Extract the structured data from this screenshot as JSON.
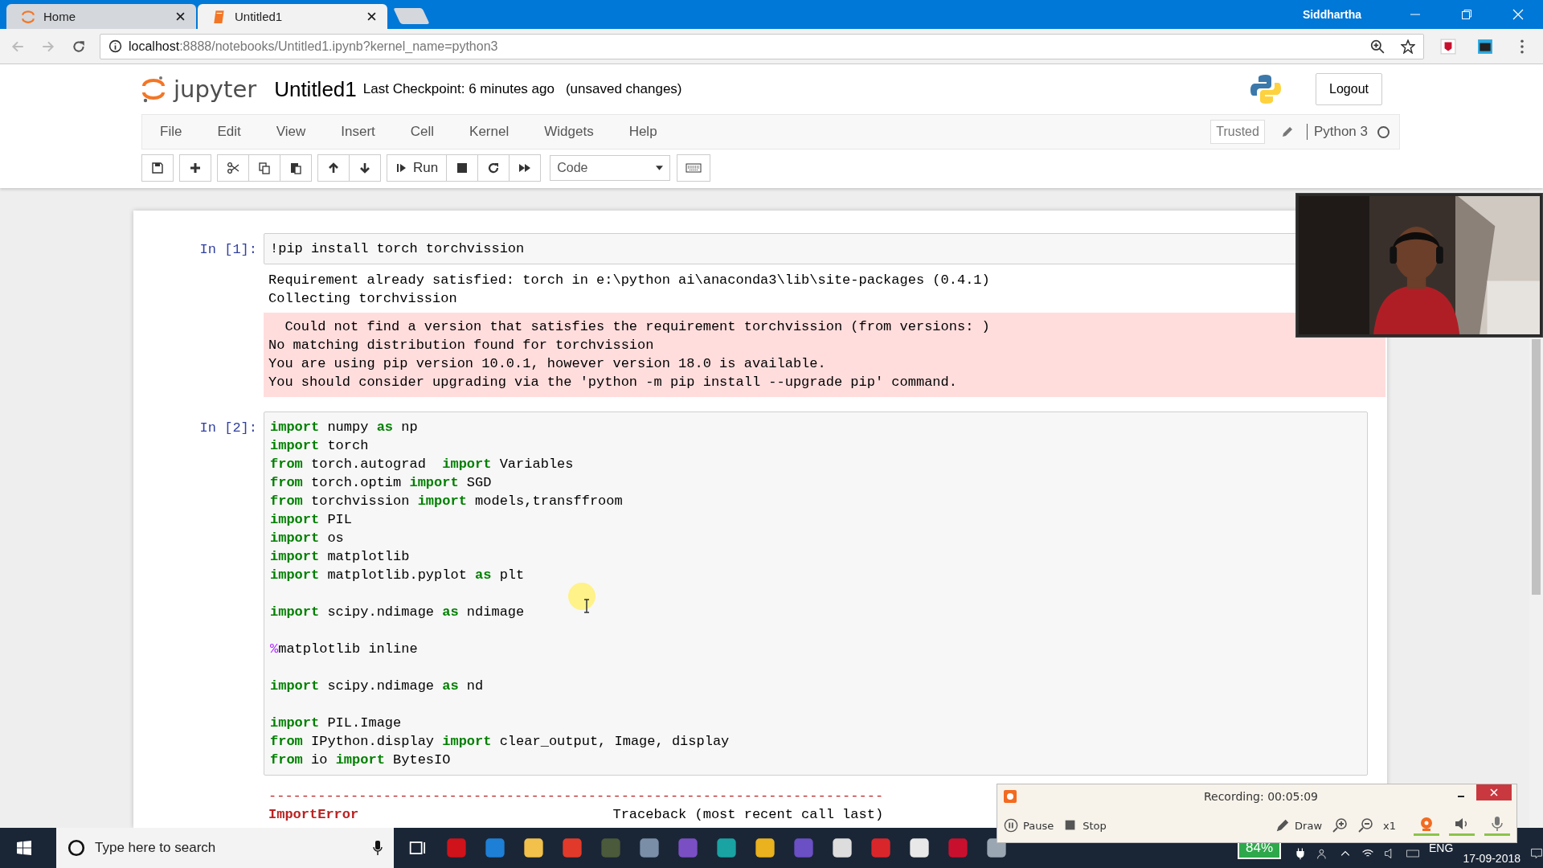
{
  "browser": {
    "tabs": [
      {
        "title": "Home",
        "selected": false
      },
      {
        "title": "Untitled1",
        "selected": true
      }
    ],
    "user": "Siddhartha",
    "url_host": "localhost",
    "url_rest": ":8888/notebooks/Untitled1.ipynb?kernel_name=python3"
  },
  "header": {
    "logo_text": "jupyter",
    "notebook_name": "Untitled1",
    "checkpoint": "Last Checkpoint: 6 minutes ago",
    "save_status": "(unsaved changes)",
    "logout": "Logout"
  },
  "menu": [
    "File",
    "Edit",
    "View",
    "Insert",
    "Cell",
    "Kernel",
    "Widgets",
    "Help"
  ],
  "kernel": {
    "trusted": "Trusted",
    "name": "Python 3",
    "busy": false
  },
  "toolbar": {
    "run": "Run",
    "cell_type": "Code"
  },
  "cells": [
    {
      "prompt": "In [1]:",
      "lines": [
        {
          "kind": "code",
          "segments": [
            {
              "kind": "plain",
              "text": "!pip install torch torchvission"
            }
          ]
        }
      ],
      "outputs": [
        {
          "kind": "stdout",
          "lines": [
            "Requirement already satisfied: torch in e:\\python ai\\anaconda3\\lib\\site-packages (0.4.1)",
            "Collecting torchvission"
          ]
        },
        {
          "kind": "stderr",
          "lines": [
            "  Could not find a version that satisfies the requirement torchvission (from versions: )",
            "No matching distribution found for torchvission",
            "You are using pip version 10.0.1, however version 18.0 is available.",
            "You should consider upgrading via the 'python -m pip install --upgrade pip' command."
          ]
        }
      ]
    },
    {
      "prompt": "In [2]:",
      "lines": [
        {
          "kind": "code",
          "segments": [
            {
              "kind": "kw",
              "text": "import"
            },
            {
              "kind": "plain",
              "text": " numpy "
            },
            {
              "kind": "kw",
              "text": "as"
            },
            {
              "kind": "plain",
              "text": " np"
            }
          ]
        },
        {
          "kind": "code",
          "segments": [
            {
              "kind": "kw",
              "text": "import"
            },
            {
              "kind": "plain",
              "text": " torch"
            }
          ]
        },
        {
          "kind": "code",
          "segments": [
            {
              "kind": "kw",
              "text": "from"
            },
            {
              "kind": "plain",
              "text": " torch.autograd  "
            },
            {
              "kind": "kw",
              "text": "import"
            },
            {
              "kind": "plain",
              "text": " Variables"
            }
          ]
        },
        {
          "kind": "code",
          "segments": [
            {
              "kind": "kw",
              "text": "from"
            },
            {
              "kind": "plain",
              "text": " torch.optim "
            },
            {
              "kind": "kw",
              "text": "import"
            },
            {
              "kind": "plain",
              "text": " SGD"
            }
          ]
        },
        {
          "kind": "code",
          "segments": [
            {
              "kind": "kw",
              "text": "from"
            },
            {
              "kind": "plain",
              "text": " torchvission "
            },
            {
              "kind": "kw",
              "text": "import"
            },
            {
              "kind": "plain",
              "text": " models,transffroom"
            }
          ]
        },
        {
          "kind": "code",
          "segments": [
            {
              "kind": "kw",
              "text": "import"
            },
            {
              "kind": "plain",
              "text": " PIL"
            }
          ]
        },
        {
          "kind": "code",
          "segments": [
            {
              "kind": "kw",
              "text": "import"
            },
            {
              "kind": "plain",
              "text": " os"
            }
          ]
        },
        {
          "kind": "code",
          "segments": [
            {
              "kind": "kw",
              "text": "import"
            },
            {
              "kind": "plain",
              "text": " matplotlib"
            }
          ]
        },
        {
          "kind": "code",
          "segments": [
            {
              "kind": "kw",
              "text": "import"
            },
            {
              "kind": "plain",
              "text": " matplotlib.pyplot "
            },
            {
              "kind": "kw",
              "text": "as"
            },
            {
              "kind": "plain",
              "text": " plt"
            }
          ]
        },
        {
          "kind": "blank"
        },
        {
          "kind": "code",
          "segments": [
            {
              "kind": "kw",
              "text": "import"
            },
            {
              "kind": "plain",
              "text": " scipy.ndimage "
            },
            {
              "kind": "kw",
              "text": "as"
            },
            {
              "kind": "plain",
              "text": " ndimage"
            }
          ]
        },
        {
          "kind": "blank"
        },
        {
          "kind": "code",
          "segments": [
            {
              "kind": "magic",
              "text": "%"
            },
            {
              "kind": "plain",
              "text": "matplotlib inline"
            }
          ]
        },
        {
          "kind": "blank"
        },
        {
          "kind": "code",
          "segments": [
            {
              "kind": "kw",
              "text": "import"
            },
            {
              "kind": "plain",
              "text": " scipy.ndimage "
            },
            {
              "kind": "kw",
              "text": "as"
            },
            {
              "kind": "plain",
              "text": " nd"
            }
          ]
        },
        {
          "kind": "blank"
        },
        {
          "kind": "code",
          "segments": [
            {
              "kind": "kw",
              "text": "import"
            },
            {
              "kind": "plain",
              "text": " PIL.Image"
            }
          ]
        },
        {
          "kind": "code",
          "segments": [
            {
              "kind": "kw",
              "text": "from"
            },
            {
              "kind": "plain",
              "text": " IPython.display "
            },
            {
              "kind": "kw",
              "text": "import"
            },
            {
              "kind": "plain",
              "text": " clear_output, Image, display"
            }
          ]
        },
        {
          "kind": "code",
          "segments": [
            {
              "kind": "kw",
              "text": "from"
            },
            {
              "kind": "plain",
              "text": " io "
            },
            {
              "kind": "kw",
              "text": "import"
            },
            {
              "kind": "plain",
              "text": " BytesIO"
            }
          ]
        }
      ],
      "outputs": [
        {
          "kind": "error",
          "lines": [
            [
              {
                "kind": "rule",
                "text": "---------------------------------------------------------------------------"
              }
            ],
            [
              {
                "kind": "ename",
                "text": "ImportError"
              },
              {
                "kind": "plain",
                "text": "                               Traceback (most recent call last)"
              }
            ]
          ]
        }
      ]
    }
  ],
  "recording": {
    "status": "Recording:  00:05:09",
    "pause": "Pause",
    "stop": "Stop",
    "draw": "Draw",
    "zoom": "x1"
  },
  "taskbar": {
    "search_placeholder": "Type here to search",
    "battery": "84%",
    "language": "ENG",
    "date": "17-09-2018"
  }
}
